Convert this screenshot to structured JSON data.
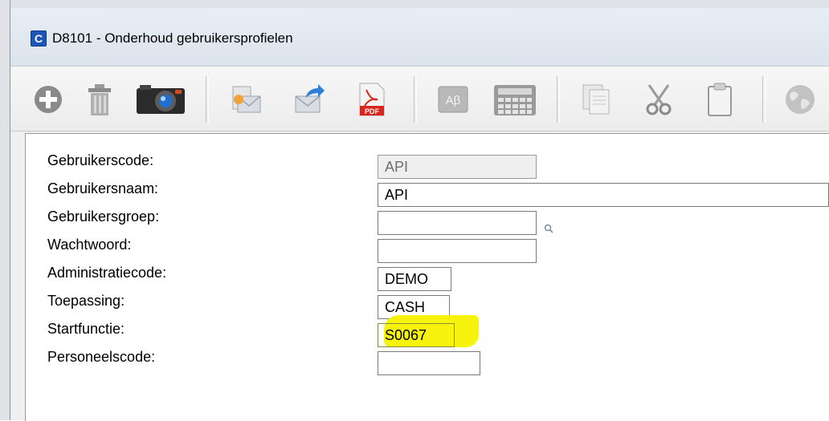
{
  "window": {
    "title": "D8101 - Onderhoud gebruikersprofielen",
    "app_icon_letter": "C"
  },
  "toolbar": {
    "buttons": [
      {
        "name": "add-icon"
      },
      {
        "name": "delete-icon"
      },
      {
        "name": "camera-icon"
      },
      {
        "name": "send-email-icon"
      },
      {
        "name": "forward-icon"
      },
      {
        "name": "pdf-icon",
        "text": "PDF"
      },
      {
        "name": "spellcheck-icon",
        "text": "Aβ"
      },
      {
        "name": "calculator-icon"
      },
      {
        "name": "copy-icon"
      },
      {
        "name": "cut-icon"
      },
      {
        "name": "paste-icon"
      },
      {
        "name": "globe-icon"
      }
    ]
  },
  "form": {
    "fields": [
      {
        "label": "Gebruikerscode:",
        "value": "API",
        "readonly": true
      },
      {
        "label": "Gebruikersnaam:",
        "value": "API"
      },
      {
        "label": "Gebruikersgroep:",
        "value": ""
      },
      {
        "label": "Wachtwoord:",
        "value": ""
      },
      {
        "label": "Administratiecode:",
        "value": "DEMO"
      },
      {
        "label": "Toepassing:",
        "value": "CASH"
      },
      {
        "label": "Startfunctie:",
        "value": "S0067",
        "highlighted": true
      },
      {
        "label": "Personeelscode:",
        "value": ""
      }
    ]
  },
  "colors": {
    "highlight": "#f7f200",
    "app_icon": "#1d56b8",
    "pdf_red": "#d9261c"
  }
}
